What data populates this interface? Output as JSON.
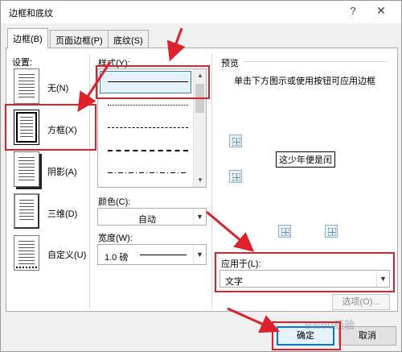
{
  "window": {
    "title": "边框和底纹",
    "help": "?",
    "close": "✕"
  },
  "tabs": [
    {
      "label": "边框(B)"
    },
    {
      "label": "页面边框(P)"
    },
    {
      "label": "底纹(S)"
    }
  ],
  "settings": {
    "heading": "设置:",
    "items": [
      {
        "label": "无(N)"
      },
      {
        "label": "方框(X)"
      },
      {
        "label": "阴影(A)"
      },
      {
        "label": "三维(D)"
      },
      {
        "label": "自定义(U)"
      }
    ]
  },
  "style": {
    "label": "样式(Y):",
    "selected_index": 0,
    "items": [
      "solid",
      "dotted",
      "dashed-small",
      "dashed",
      "dash-dot"
    ]
  },
  "color": {
    "label": "颜色(C):",
    "value": "自动"
  },
  "width": {
    "label": "宽度(W):",
    "value": "1.0 磅"
  },
  "preview": {
    "label": "预览",
    "hint": "单击下方图示或使用按钮可应用边框",
    "sample_text": "这少年便是闰"
  },
  "apply_to": {
    "label": "应用于(L):",
    "value": "文字"
  },
  "buttons": {
    "options": "选项(O)...",
    "ok": "确定",
    "cancel": "取消"
  },
  "watermark": "Baidu经验",
  "colors": {
    "annotation": "#e0202a",
    "accent": "#0078d7"
  }
}
